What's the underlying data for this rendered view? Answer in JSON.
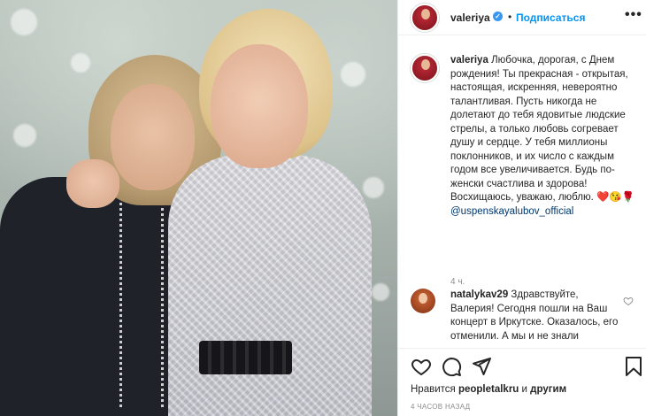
{
  "header": {
    "username": "valeriya",
    "verified_symbol": "✓",
    "separator": "•",
    "follow_label": "Подписаться",
    "more_label": "•••"
  },
  "caption": {
    "username": "valeriya",
    "text": "Любочка, дорогая, с Днем рождения! Ты прекрасная - открытая, настоящая, искренняя, невероятно талантливая. Пусть никогда не долетают до тебя ядовитые людские стрелы, а только любовь согревает душу и сердце. У тебя миллионы поклонников, и их число с каждым годом все увеличивается. Будь по-женски счастлива и здорова! Восхищаюсь, уважаю, люблю.",
    "emoji": "❤️😘🌹",
    "mention": "@uspenskayalubov_official",
    "time": "4 ч."
  },
  "comment": {
    "username": "natalykav29",
    "text": "Здравствуйте, Валерия! Сегодня пошли на Ваш концерт в Иркутске. Оказалось, его отменили. А мы и не знали"
  },
  "actions": {
    "like_icon": "heart-icon",
    "comment_icon": "comment-icon",
    "share_icon": "share-icon",
    "save_icon": "bookmark-icon"
  },
  "likes": {
    "prefix": "Нравится ",
    "user": "peopletalkru",
    "suffix_and": " и ",
    "others": "другим"
  },
  "posted": "4 ЧАСОВ НАЗАД"
}
